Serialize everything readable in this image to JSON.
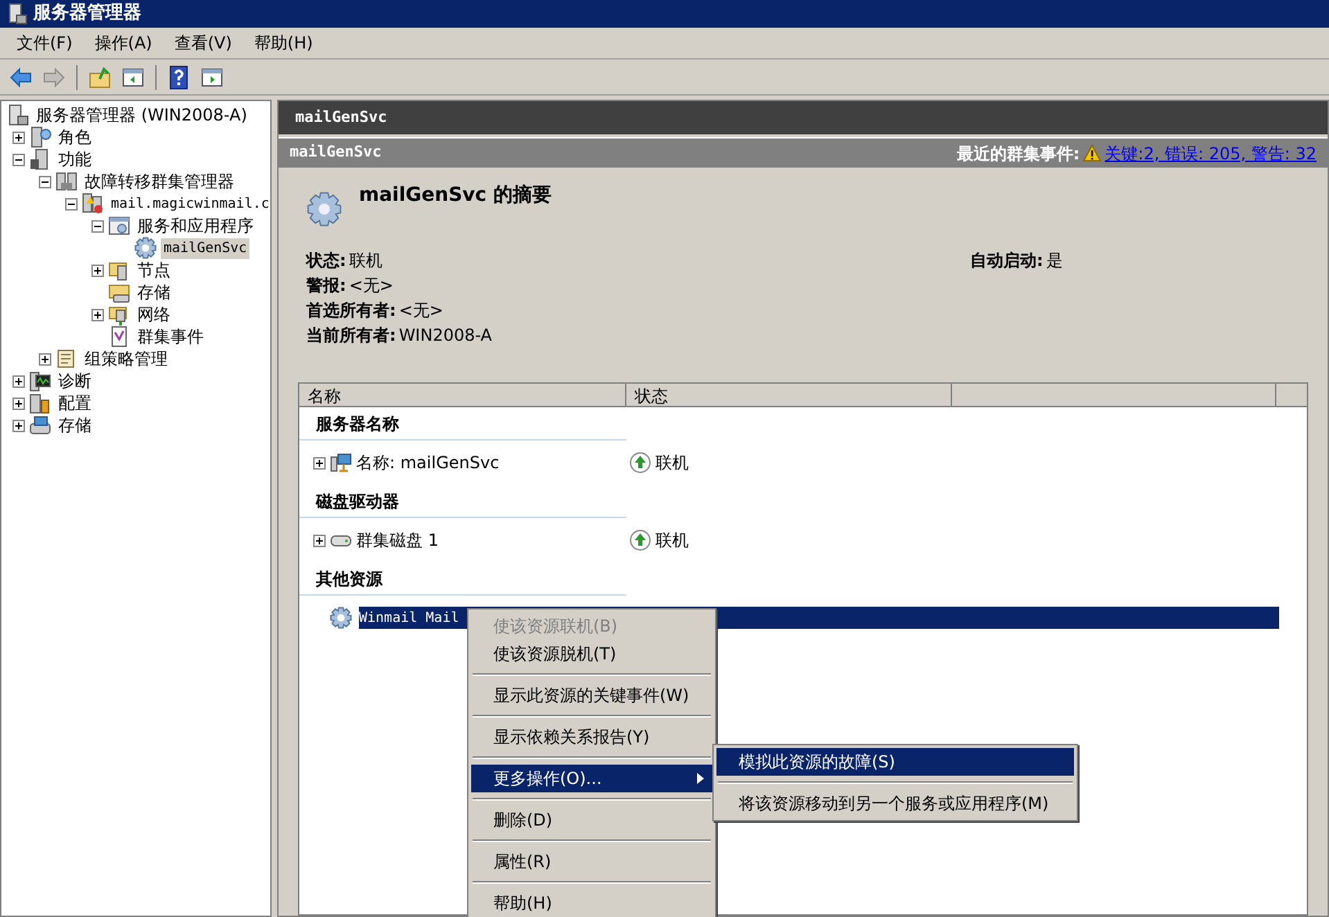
{
  "window": {
    "title": "服务器管理器"
  },
  "menu_bar": [
    "文件(F)",
    "操作(A)",
    "查看(V)",
    "帮助(H)"
  ],
  "toolbar": [
    {
      "kind": "back",
      "disabled": false
    },
    {
      "kind": "forward",
      "disabled": true
    },
    {
      "kind": "up",
      "disabled": false
    },
    {
      "kind": "pane-left",
      "disabled": false
    },
    {
      "kind": "help",
      "disabled": false
    },
    {
      "kind": "pane-right",
      "disabled": false
    }
  ],
  "tree": [
    {
      "label": "服务器管理器 (WIN2008-A)",
      "kind": "server",
      "selected": false,
      "children": [
        {
          "label": "角色",
          "kind": "roles",
          "expanded": false,
          "selected": false
        },
        {
          "label": "功能",
          "kind": "features",
          "expanded": true,
          "selected": false,
          "children": [
            {
              "label": "故障转移群集管理器",
              "kind": "cluster",
              "expanded": true,
              "selected": false,
              "children": [
                {
                  "label": "mail.magicwinmail.c",
                  "kind": "cluster-node",
                  "expanded": true,
                  "selected": false,
                  "children": [
                    {
                      "label": "服务和应用程序",
                      "kind": "services",
                      "expanded": true,
                      "selected": false,
                      "children": [
                        {
                          "label": "mailGenSvc",
                          "kind": "gear",
                          "selected": true
                        }
                      ]
                    },
                    {
                      "label": "节点",
                      "kind": "node",
                      "expanded": false,
                      "selected": false
                    },
                    {
                      "label": "存储",
                      "kind": "storage-folder",
                      "selected": false
                    },
                    {
                      "label": "网络",
                      "kind": "network",
                      "expanded": false,
                      "selected": false
                    },
                    {
                      "label": "群集事件",
                      "kind": "events",
                      "selected": false
                    }
                  ]
                }
              ]
            },
            {
              "label": "组策略管理",
              "kind": "policy",
              "expanded": false,
              "selected": false
            }
          ]
        },
        {
          "label": "诊断",
          "kind": "diagnostics",
          "expanded": false,
          "selected": false
        },
        {
          "label": "配置",
          "kind": "config",
          "expanded": false,
          "selected": false
        },
        {
          "label": "存储",
          "kind": "storage",
          "expanded": false,
          "selected": false
        }
      ]
    }
  ],
  "pane_title": "mailGenSvc",
  "section": {
    "title": "mailGenSvc",
    "events_label": "最近的群集事件:",
    "events_link": "关键:2, 错误: 205, 警告: 32"
  },
  "summary": {
    "title": "mailGenSvc 的摘要",
    "left": [
      {
        "label": "状态:",
        "value": "联机"
      },
      {
        "label": "警报:",
        "value": "<无>"
      },
      {
        "label": "首选所有者:",
        "value": "<无>"
      },
      {
        "label": "当前所有者:",
        "value": "WIN2008-A"
      }
    ],
    "right": [
      {
        "label": "自动启动:",
        "value": "是"
      }
    ]
  },
  "table": {
    "columns": [
      "名称",
      "状态"
    ],
    "groups": [
      {
        "title": "服务器名称",
        "rows": [
          {
            "name": "名称: mailGenSvc",
            "kind": "network-name",
            "expandable": true,
            "status": "联机",
            "selected": false
          }
        ]
      },
      {
        "title": "磁盘驱动器",
        "rows": [
          {
            "name": "群集磁盘 1",
            "kind": "disk",
            "expandable": true,
            "status": "联机",
            "selected": false
          }
        ]
      },
      {
        "title": "其他资源",
        "rows": [
          {
            "name": "Winmail Mail",
            "kind": "gear",
            "expandable": false,
            "selected": true
          }
        ]
      }
    ]
  },
  "context_menu": [
    [
      {
        "label": "使该资源联机(B)",
        "disabled": true,
        "selected": false
      },
      {
        "label": "使该资源脱机(T)",
        "disabled": false,
        "selected": false
      }
    ],
    [
      {
        "label": "显示此资源的关键事件(W)",
        "disabled": false,
        "selected": false
      }
    ],
    [
      {
        "label": "显示依赖关系报告(Y)",
        "disabled": false,
        "selected": false
      }
    ],
    [
      {
        "label": "更多操作(O)...",
        "disabled": false,
        "selected": true,
        "submenu": true
      }
    ],
    [
      {
        "label": "删除(D)",
        "disabled": false,
        "selected": false
      }
    ],
    [
      {
        "label": "属性(R)",
        "disabled": false,
        "selected": false
      }
    ],
    [
      {
        "label": "帮助(H)",
        "disabled": false,
        "selected": false
      }
    ]
  ],
  "submenu": [
    [
      {
        "label": "模拟此资源的故障(S)",
        "selected": true
      }
    ],
    [
      {
        "label": "将该资源移动到另一个服务或应用程序(M)",
        "selected": false
      }
    ]
  ]
}
